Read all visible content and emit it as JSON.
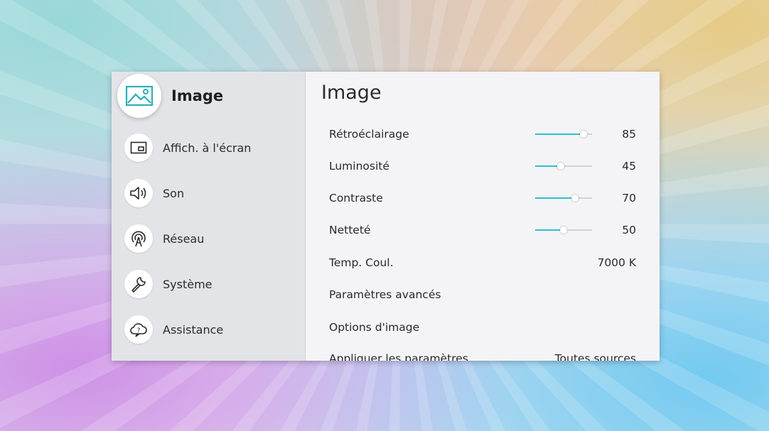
{
  "sidebar": {
    "items": [
      {
        "label": "Image",
        "icon": "picture-icon"
      },
      {
        "label": "Affich. à l'écran",
        "icon": "picture-in-picture-icon"
      },
      {
        "label": "Son",
        "icon": "speaker-icon"
      },
      {
        "label": "Réseau",
        "icon": "network-icon"
      },
      {
        "label": "Système",
        "icon": "wrench-icon"
      },
      {
        "label": "Assistance",
        "icon": "support-cloud-icon"
      }
    ]
  },
  "main": {
    "title": "Image",
    "settings": [
      {
        "label": "Rétroéclairage",
        "value": "85",
        "level": 85
      },
      {
        "label": "Luminosité",
        "value": "45",
        "level": 45
      },
      {
        "label": "Contraste",
        "value": "70",
        "level": 70
      },
      {
        "label": "Netteté",
        "value": "50",
        "level": 50
      },
      {
        "label": "Temp. Coul.",
        "value": "7000 K"
      },
      {
        "label": "Paramètres avancés"
      },
      {
        "label": "Options d'image"
      },
      {
        "label": "Appliquer les paramètres",
        "value": "Toutes sources"
      }
    ]
  },
  "colors": {
    "accent": "#2bc3c8",
    "icon": "#2a9aa0"
  }
}
